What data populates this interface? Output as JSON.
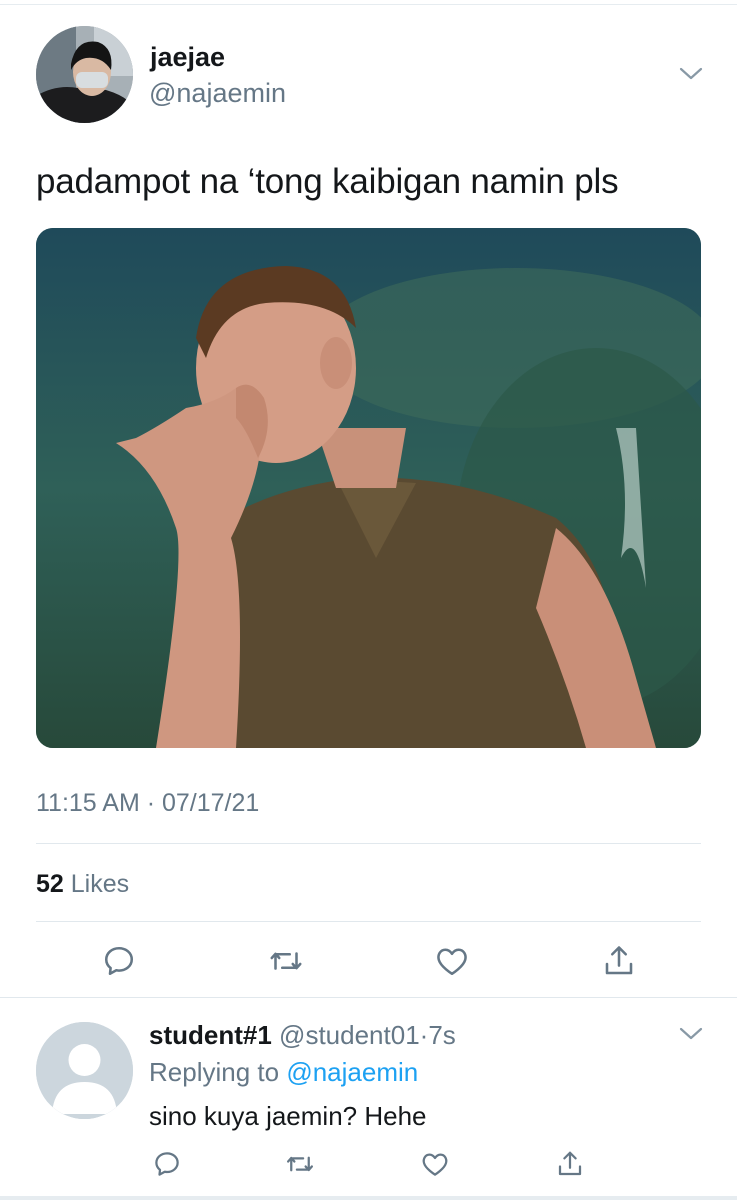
{
  "tweet": {
    "display_name": "jaejae",
    "handle": "@najaemin",
    "text": "padampot na ‘tong kaibigan namin pls",
    "timestamp": "11:15 AM · 07/17/21",
    "likes_count": "52",
    "likes_label": " Likes",
    "media_icon": "photo",
    "actions": [
      "reply-icon",
      "retweet-icon",
      "like-icon",
      "share-icon"
    ]
  },
  "reply": {
    "display_name": "student#1",
    "handle": "@student01",
    "age": "7s",
    "separator": "·",
    "replying_prefix": "Replying to ",
    "replying_to": "@najaemin",
    "text": "sino kuya jaemin? Hehe",
    "actions": [
      "reply-icon",
      "retweet-icon",
      "like-icon",
      "share-icon"
    ]
  },
  "colors": {
    "accent": "#1da1f2",
    "secondary_text": "#657786",
    "primary_text": "#14171a",
    "icon": "#657786"
  }
}
